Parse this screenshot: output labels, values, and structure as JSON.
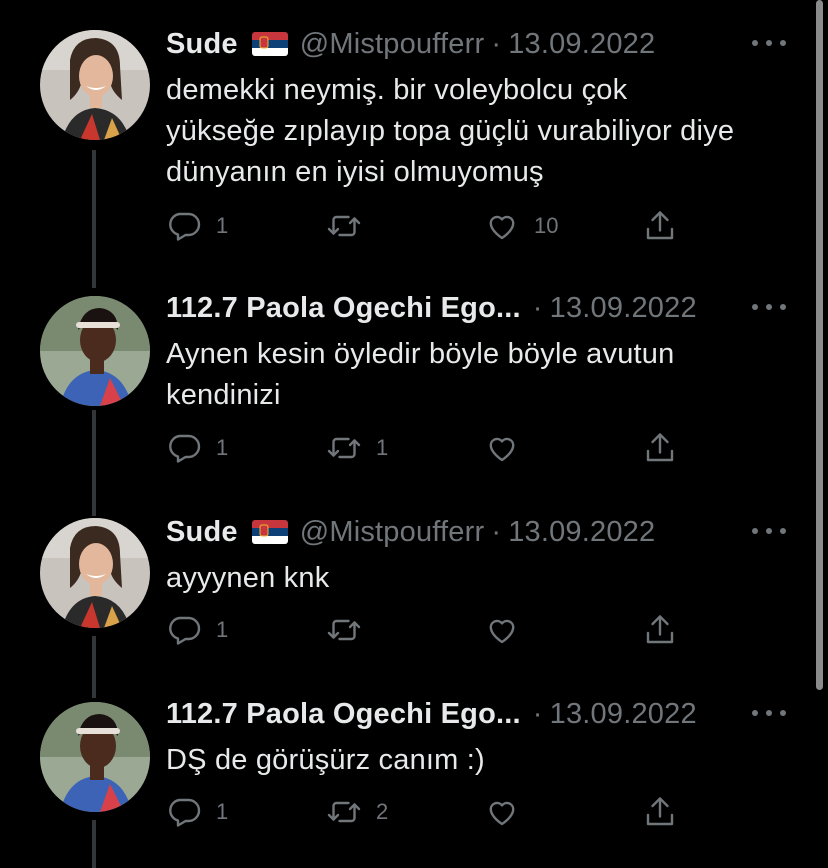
{
  "tweets": [
    {
      "name": "Sude",
      "handle": "@Mistpoufferr",
      "separator": "·",
      "date": "13.09.2022",
      "text": "demekki neymiş. bir voleybolcu çok\nyükseğe zıplayıp topa güçlü vurabiliyor diye\ndünyanın en iyisi olmuyomuş",
      "reply_count": "1",
      "retweet_count": "",
      "like_count": "10"
    },
    {
      "name": "112.7 Paola Ogechi Ego...",
      "handle": "",
      "separator": "·",
      "date": "13.09.2022",
      "text": "Aynen kesin öyledir böyle böyle avutun\nkendinizi",
      "reply_count": "1",
      "retweet_count": "1",
      "like_count": ""
    },
    {
      "name": "Sude",
      "handle": "@Mistpoufferr",
      "separator": "·",
      "date": "13.09.2022",
      "text": "ayyynen knk",
      "reply_count": "1",
      "retweet_count": "",
      "like_count": ""
    },
    {
      "name": "112.7 Paola Ogechi Ego...",
      "handle": "",
      "separator": "·",
      "date": "13.09.2022",
      "text": "DŞ de görüşürz canım :)",
      "reply_count": "1",
      "retweet_count": "2",
      "like_count": ""
    }
  ],
  "icons": {
    "flag": "serbia-flag-icon",
    "more": "more-options-icon",
    "reply": "reply-icon",
    "retweet": "retweet-icon",
    "like": "heart-icon",
    "share": "share-icon"
  },
  "colors": {
    "background": "#000000",
    "text": "#e7e9ea",
    "secondary": "#71767b",
    "thread_line": "#333639"
  }
}
